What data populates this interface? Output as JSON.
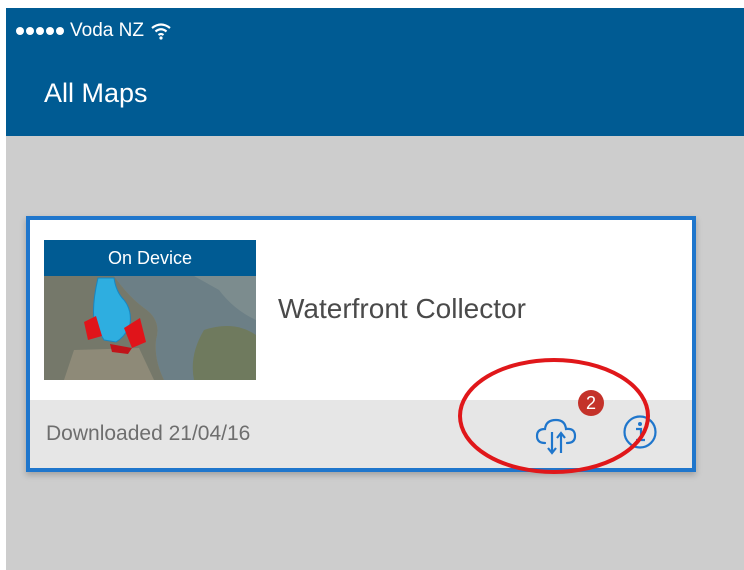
{
  "status_bar": {
    "carrier": "Voda NZ"
  },
  "header": {
    "title": "All Maps"
  },
  "map_card": {
    "badge": "On Device",
    "title": "Waterfront Collector",
    "downloaded": "Downloaded 21/04/16",
    "sync_count": "2"
  },
  "icons": {
    "signal": "signal-dots-icon",
    "wifi": "wifi-icon",
    "sync": "cloud-sync-icon",
    "info": "info-icon"
  },
  "colors": {
    "header": "#005b93",
    "card_border": "#1f76cc",
    "badge_red": "#c4322a",
    "highlight_circle": "#e0171a"
  }
}
